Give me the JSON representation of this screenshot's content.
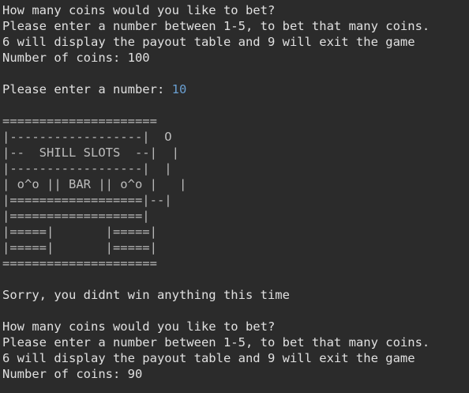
{
  "colors": {
    "background": "#2b2b2b",
    "text": "#e0e0e0",
    "user_input": "#6a9fd1"
  },
  "console": {
    "prompt1": {
      "question": "How many coins would you like to bet?",
      "instructions": "Please enter a number between 1-5, to bet that many coins.",
      "options": "6 will display the payout table and 9 will exit the game",
      "coins": "Number of coins: 100"
    },
    "entry": {
      "label": "Please enter a number: ",
      "value": "10"
    },
    "slot_art": [
      "=====================",
      "|------------------|  O",
      "|--  SHILL SLOTS  --|  |",
      "|------------------|  |",
      "| o^o || BAR || o^o |   |",
      "|==================|--|",
      "|==================|",
      "|=====|       |=====|",
      "|=====|       |=====|",
      "====================="
    ],
    "result": "Sorry, you didnt win anything this time",
    "prompt2": {
      "question": "How many coins would you like to bet?",
      "instructions": "Please enter a number between 1-5, to bet that many coins.",
      "options": "6 will display the payout table and 9 will exit the game",
      "coins": "Number of coins: 90"
    }
  }
}
